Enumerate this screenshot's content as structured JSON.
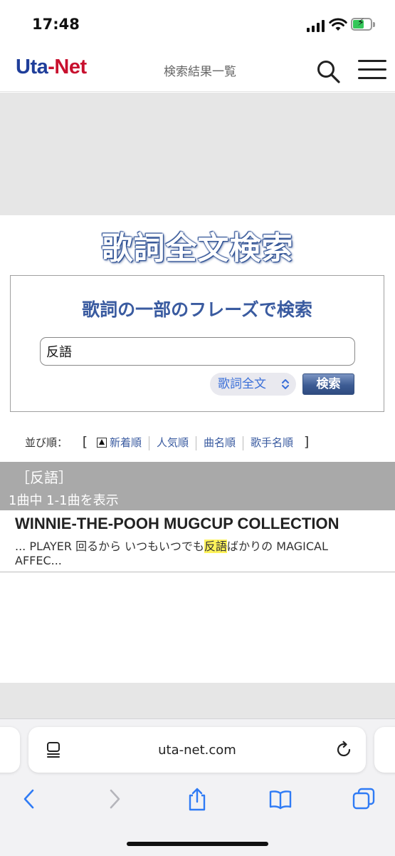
{
  "status_bar": {
    "time": "17:48"
  },
  "header": {
    "logo_uta": "Uta",
    "logo_dash": "-",
    "logo_net": "Net",
    "title": "検索結果一覧",
    "search_icon": "search-icon",
    "menu_icon": "hamburger-menu-icon"
  },
  "page_heading": "歌詞全文検索",
  "search": {
    "heading": "歌詞の一部のフレーズで検索",
    "query_value": "反語",
    "mode_selected": "歌詞全文",
    "submit_label": "検索"
  },
  "sort": {
    "label": "並び順：",
    "open_bracket": "[",
    "close_bracket": "]",
    "options": [
      "新着順",
      "人気順",
      "曲名順",
      "歌手名順"
    ]
  },
  "results": {
    "query_label": "［反語］",
    "count_text": "1曲中 1-1曲を表示",
    "items": [
      {
        "title": "WINNIE-THE-POOH MUGCUP COLLECTION",
        "snippet_before": "... PLAYER 回るから いつもいつでも",
        "snippet_highlight": "反語",
        "snippet_after": "ばかりの MAGICAL AFFEC..."
      }
    ]
  },
  "browser": {
    "url": "uta-net.com"
  },
  "colors": {
    "brand_blue": "#1f3e9a",
    "brand_red": "#c8102e",
    "link_blue": "#3a5ba0",
    "highlight": "#fff35a"
  }
}
